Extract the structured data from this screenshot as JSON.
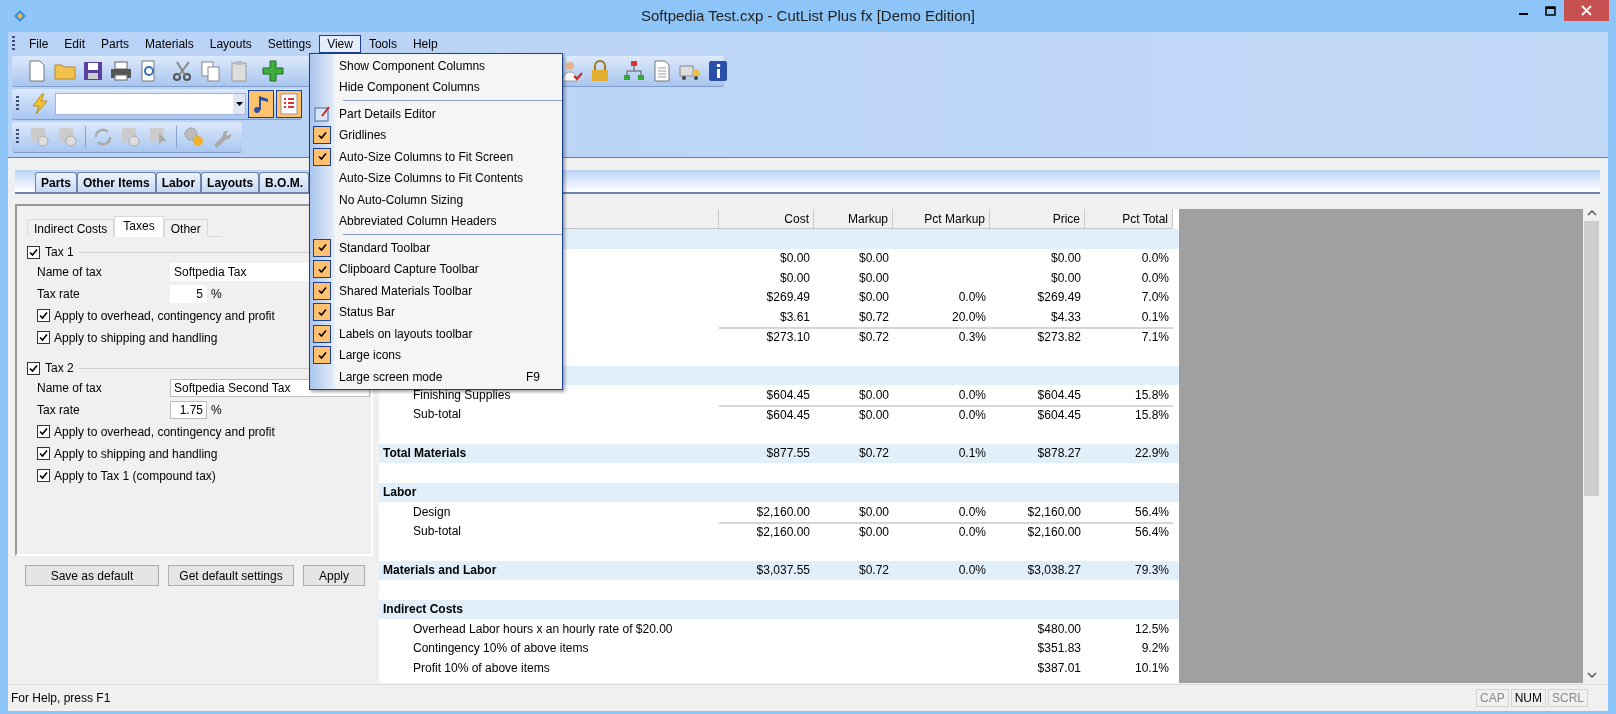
{
  "window": {
    "title": "Softpedia Test.cxp - CutList Plus fx [Demo Edition]"
  },
  "menu_bar": [
    {
      "label": "File",
      "selected": false
    },
    {
      "label": "Edit",
      "selected": false
    },
    {
      "label": "Parts",
      "selected": false
    },
    {
      "label": "Materials",
      "selected": false
    },
    {
      "label": "Layouts",
      "selected": false
    },
    {
      "label": "Settings",
      "selected": false
    },
    {
      "label": "View",
      "selected": true
    },
    {
      "label": "Tools",
      "selected": false
    },
    {
      "label": "Help",
      "selected": false
    }
  ],
  "view_menu": {
    "groups": [
      {
        "items": [
          {
            "label": "Show Component Columns",
            "kind": "toggle",
            "checked": false
          },
          {
            "label": "Hide Component Columns",
            "kind": "toggle",
            "checked": false
          }
        ]
      },
      {
        "items": [
          {
            "label": "Part Details Editor",
            "kind": "icon",
            "checked": false
          },
          {
            "label": "Gridlines",
            "kind": "toggle",
            "checked": true
          },
          {
            "label": "Auto-Size Columns to Fit Screen",
            "kind": "toggle",
            "checked": true
          },
          {
            "label": "Auto-Size Columns to Fit Contents",
            "kind": "toggle",
            "checked": false
          },
          {
            "label": "No Auto-Column Sizing",
            "kind": "toggle",
            "checked": false
          },
          {
            "label": "Abbreviated Column Headers",
            "kind": "toggle",
            "checked": false
          }
        ]
      },
      {
        "items": [
          {
            "label": "Standard Toolbar",
            "kind": "toggle",
            "checked": true
          },
          {
            "label": "Clipboard Capture Toolbar",
            "kind": "toggle",
            "checked": true
          },
          {
            "label": "Shared Materials Toolbar",
            "kind": "toggle",
            "checked": true
          },
          {
            "label": "Status Bar",
            "kind": "toggle",
            "checked": true
          },
          {
            "label": "Labels on layouts toolbar",
            "kind": "toggle",
            "checked": true
          },
          {
            "label": "Large icons",
            "kind": "toggle",
            "checked": true
          },
          {
            "label": "Large screen mode",
            "kind": "toggle",
            "checked": false,
            "shortcut": "F9"
          }
        ]
      }
    ]
  },
  "main_tabs": [
    {
      "label": "Parts",
      "selected": false
    },
    {
      "label": "Other Items",
      "selected": false
    },
    {
      "label": "Labor",
      "selected": false
    },
    {
      "label": "Layouts",
      "selected": false
    },
    {
      "label": "B.O.M.",
      "selected": false
    }
  ],
  "settings_panel": {
    "tabs": [
      {
        "label": "Indirect Costs",
        "selected": false
      },
      {
        "label": "Taxes",
        "selected": true
      },
      {
        "label": "Other",
        "selected": false
      }
    ],
    "taxes": [
      {
        "title": "Tax 1",
        "checked": true,
        "name_label": "Name of tax",
        "name_value": "Softpedia Tax",
        "rate_label": "Tax rate",
        "rate_value": "5",
        "unit": "%",
        "options": [
          {
            "label": "Apply to overhead, contingency and profit",
            "checked": true
          },
          {
            "label": "Apply to shipping and handling",
            "checked": true
          }
        ]
      },
      {
        "title": "Tax 2",
        "checked": true,
        "name_label": "Name of tax",
        "name_value": "Softpedia Second Tax",
        "rate_label": "Tax rate",
        "rate_value": "1.75",
        "unit": "%",
        "options": [
          {
            "label": "Apply to overhead, contingency and profit",
            "checked": true
          },
          {
            "label": "Apply to shipping and handling",
            "checked": true
          },
          {
            "label": "Apply to Tax 1 (compound tax)",
            "checked": true
          }
        ]
      }
    ],
    "buttons": [
      "Save as default",
      "Get default settings",
      "Apply"
    ]
  },
  "table": {
    "columns": [
      "Cost",
      "Markup",
      "Pct Markup",
      "Price",
      "Pct Total"
    ],
    "rows": [
      {
        "kind": "band"
      },
      {
        "kind": "item",
        "cost": "$0.00",
        "markup": "$0.00",
        "price": "$0.00",
        "pct_total": "0.0%"
      },
      {
        "kind": "item",
        "cost": "$0.00",
        "markup": "$0.00",
        "price": "$0.00",
        "pct_total": "0.0%"
      },
      {
        "kind": "item",
        "cost": "$269.49",
        "markup": "$0.00",
        "pct_markup": "0.0%",
        "price": "$269.49",
        "pct_total": "7.0%"
      },
      {
        "kind": "item",
        "cost": "$3.61",
        "markup": "$0.72",
        "pct_markup": "20.0%",
        "price": "$4.33",
        "pct_total": "0.1%"
      },
      {
        "kind": "subtotal",
        "cost": "$273.10",
        "markup": "$0.72",
        "pct_markup": "0.3%",
        "price": "$273.82",
        "pct_total": "7.1%"
      },
      {
        "kind": "blank"
      },
      {
        "kind": "band"
      },
      {
        "kind": "item",
        "label": "Finishing Supplies",
        "cost": "$604.45",
        "markup": "$0.00",
        "pct_markup": "0.0%",
        "price": "$604.45",
        "pct_total": "15.8%"
      },
      {
        "kind": "subtotal",
        "label": "Sub-total",
        "cost": "$604.45",
        "markup": "$0.00",
        "pct_markup": "0.0%",
        "price": "$604.45",
        "pct_total": "15.8%"
      },
      {
        "kind": "blank"
      },
      {
        "kind": "total",
        "label": "Total Materials",
        "cost": "$877.55",
        "markup": "$0.72",
        "pct_markup": "0.1%",
        "price": "$878.27",
        "pct_total": "22.9%"
      },
      {
        "kind": "blank"
      },
      {
        "kind": "band",
        "label": "Labor"
      },
      {
        "kind": "item",
        "label": "Design",
        "cost": "$2,160.00",
        "markup": "$0.00",
        "pct_markup": "0.0%",
        "price": "$2,160.00",
        "pct_total": "56.4%"
      },
      {
        "kind": "subtotal",
        "label": "Sub-total",
        "cost": "$2,160.00",
        "markup": "$0.00",
        "pct_markup": "0.0%",
        "price": "$2,160.00",
        "pct_total": "56.4%"
      },
      {
        "kind": "blank"
      },
      {
        "kind": "total",
        "label": "Materials and Labor",
        "cost": "$3,037.55",
        "markup": "$0.72",
        "pct_markup": "0.0%",
        "price": "$3,038.27",
        "pct_total": "79.3%"
      },
      {
        "kind": "blank"
      },
      {
        "kind": "band",
        "label": "Indirect Costs"
      },
      {
        "kind": "item",
        "label": "Overhead Labor hours x an hourly rate of $20.00",
        "price": "$480.00",
        "pct_total": "12.5%"
      },
      {
        "kind": "item",
        "label": "Contingency 10% of above items",
        "price": "$351.83",
        "pct_total": "9.2%"
      },
      {
        "kind": "item",
        "label": "Profit 10% of above items",
        "price": "$387.01",
        "pct_total": "10.1%"
      }
    ]
  },
  "status_bar": {
    "message": "For Help, press F1",
    "indicators": [
      {
        "label": "CAP",
        "on": false
      },
      {
        "label": "NUM",
        "on": true
      },
      {
        "label": "SCRL",
        "on": false
      }
    ]
  }
}
